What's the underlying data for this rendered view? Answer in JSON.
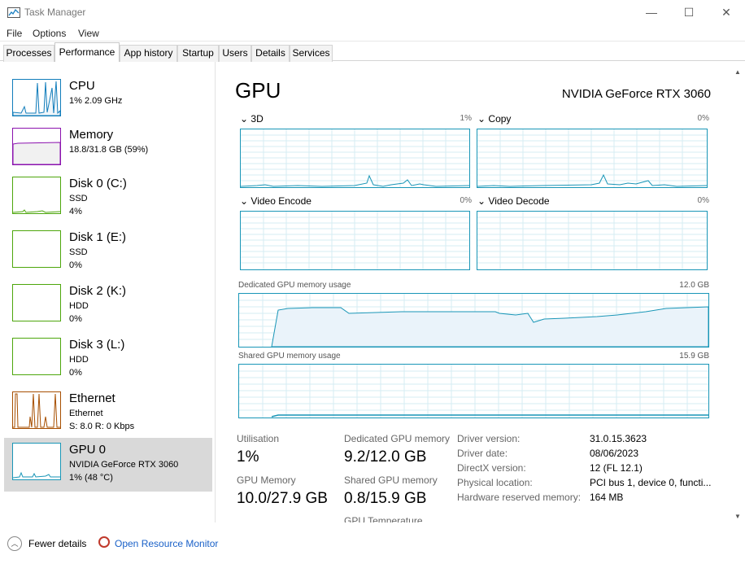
{
  "window": {
    "title": "Task Manager",
    "minimize": "—",
    "maximize": "☐",
    "close": "✕"
  },
  "menu": [
    "File",
    "Options",
    "View"
  ],
  "tabs": [
    "Processes",
    "Performance",
    "App history",
    "Startup",
    "Users",
    "Details",
    "Services"
  ],
  "active_tab": "Performance",
  "resources": [
    {
      "name": "CPU",
      "line2": "1% 2.09 GHz",
      "line3": "",
      "color": "#117dbb"
    },
    {
      "name": "Memory",
      "line2": "18.8/31.8 GB (59%)",
      "line3": "",
      "color": "#8b12ae"
    },
    {
      "name": "Disk 0 (C:)",
      "line2": "SSD",
      "line3": "4%",
      "color": "#4da60c"
    },
    {
      "name": "Disk 1 (E:)",
      "line2": "SSD",
      "line3": "0%",
      "color": "#4da60c"
    },
    {
      "name": "Disk 2 (K:)",
      "line2": "HDD",
      "line3": "0%",
      "color": "#4da60c"
    },
    {
      "name": "Disk 3 (L:)",
      "line2": "HDD",
      "line3": "0%",
      "color": "#4da60c"
    },
    {
      "name": "Ethernet",
      "line2": "Ethernet",
      "line3": "S: 8.0  R: 0 Kbps",
      "color": "#a74f01"
    },
    {
      "name": "GPU 0",
      "line2": "NVIDIA GeForce RTX 3060",
      "line3": "1% (48 °C)",
      "color": "#1996b7"
    }
  ],
  "gpu": {
    "title": "GPU",
    "model": "NVIDIA GeForce RTX 3060",
    "engines": [
      {
        "label": "3D",
        "pct": "1%"
      },
      {
        "label": "Copy",
        "pct": "0%"
      },
      {
        "label": "Video Encode",
        "pct": "0%"
      },
      {
        "label": "Video Decode",
        "pct": "0%"
      }
    ],
    "dedicated_label": "Dedicated GPU memory usage",
    "dedicated_max": "12.0 GB",
    "shared_label": "Shared GPU memory usage",
    "shared_max": "15.9 GB",
    "stats": {
      "utilisation_label": "Utilisation",
      "utilisation": "1%",
      "dedicated_label": "Dedicated GPU memory",
      "dedicated": "9.2/12.0 GB",
      "gpu_memory_label": "GPU Memory",
      "gpu_memory": "10.0/27.9 GB",
      "shared_label": "Shared GPU memory",
      "shared": "0.8/15.9 GB",
      "temperature_label": "GPU Temperature"
    },
    "info": [
      {
        "k": "Driver version:",
        "v": "31.0.15.3623"
      },
      {
        "k": "Driver date:",
        "v": "08/06/2023"
      },
      {
        "k": "DirectX version:",
        "v": "12 (FL 12.1)"
      },
      {
        "k": "Physical location:",
        "v": "PCI bus 1, device 0, functi..."
      },
      {
        "k": "Hardware reserved memory:",
        "v": "164 MB"
      }
    ]
  },
  "footer": {
    "fewer_details": "Fewer details",
    "open_resource_monitor": "Open Resource Monitor"
  }
}
